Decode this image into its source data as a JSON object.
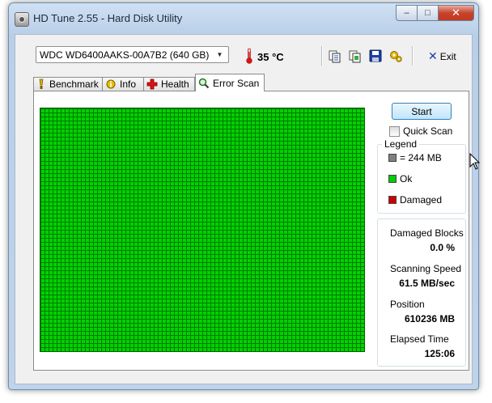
{
  "window": {
    "title": "HD Tune 2.55 - Hard Disk Utility",
    "caption": {
      "minimize": "–",
      "maximize": "□",
      "close": "✕"
    }
  },
  "toolbar": {
    "drive": "WDC WD6400AAKS-00A7B2 (640 GB)",
    "temperature": "35 °C",
    "icons": [
      "copy-text-icon",
      "copy-screenshot-icon",
      "save-icon",
      "options-icon"
    ],
    "exit_label": "Exit"
  },
  "tabs": [
    {
      "label": "Benchmark",
      "icon": "benchmark-icon"
    },
    {
      "label": "Info",
      "icon": "info-icon"
    },
    {
      "label": "Health",
      "icon": "health-icon"
    },
    {
      "label": "Error Scan",
      "icon": "magnifier-icon",
      "active": true
    }
  ],
  "error_scan": {
    "start_label": "Start",
    "quick_scan_label": "Quick Scan",
    "quick_scan_checked": false,
    "legend": {
      "title": "Legend",
      "items": [
        {
          "label": "= 244 MB",
          "color": "#808080"
        },
        {
          "label": "Ok",
          "color": "#00cc00"
        },
        {
          "label": "Damaged",
          "color": "#cc0000"
        }
      ]
    },
    "stats": {
      "damaged_blocks_label": "Damaged Blocks",
      "damaged_blocks_value": "0.0 %",
      "scanning_speed_label": "Scanning Speed",
      "scanning_speed_value": "61.5 MB/sec",
      "position_label": "Position",
      "position_value": "610236 MB",
      "elapsed_time_label": "Elapsed Time",
      "elapsed_time_value": "125:06"
    },
    "block_color_ok": "#00d200"
  }
}
